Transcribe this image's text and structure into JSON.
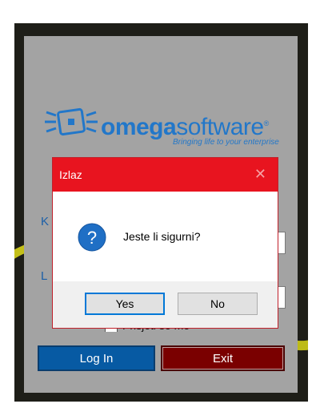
{
  "logo": {
    "brand_bold": "omega",
    "brand_light": "software",
    "trademark": "®",
    "tagline": "Bringing life to your enterprise",
    "icon": "omega-logo-icon"
  },
  "background_labels": {
    "first_partial": "K",
    "second_partial": "L"
  },
  "remember": {
    "label": "Prisjeti se me"
  },
  "buttons": {
    "login": "Log In",
    "exit": "Exit"
  },
  "dialog": {
    "title": "Izlaz",
    "message": "Jeste li sigurni?",
    "icon": "question-icon",
    "yes_label": "Yes",
    "no_label": "No",
    "close_icon": "close-icon"
  },
  "colors": {
    "title_bar": "#e8141f",
    "brand_blue": "#2277c9",
    "login_button": "#075aa3",
    "exit_button": "#7a0000",
    "panel": "#a3a3a3"
  }
}
